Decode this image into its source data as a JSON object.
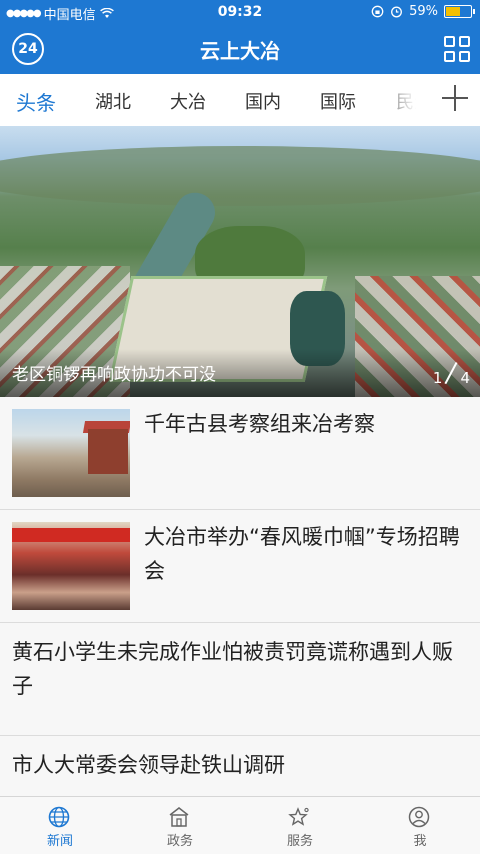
{
  "status_bar": {
    "carrier": "中国电信",
    "time": "09:32",
    "battery": "59%",
    "battery_level": 0.59
  },
  "header": {
    "logo": "24",
    "title": "云上大冶"
  },
  "tabs": [
    {
      "label": "头条",
      "active": true
    },
    {
      "label": "湖北"
    },
    {
      "label": "大冶"
    },
    {
      "label": "国内"
    },
    {
      "label": "国际"
    },
    {
      "label": "民生"
    }
  ],
  "hero": {
    "caption": "老区铜锣再响政协功不可没",
    "page_current": "1",
    "page_total": "4"
  },
  "news": [
    {
      "title": "千年古县考察组来冶考察",
      "has_image": true
    },
    {
      "title": "大冶市举办“春风暖巾帼”专场招聘会",
      "has_image": true
    },
    {
      "title": "黄石小学生未完成作业怕被责罚竟谎称遇到人贩子",
      "has_image": false
    },
    {
      "title": "市人大常委会领导赴铁山调研",
      "has_image": false
    }
  ],
  "bottom_nav": [
    {
      "label": "新闻",
      "icon": "globe-icon",
      "active": true
    },
    {
      "label": "政务",
      "icon": "government-icon"
    },
    {
      "label": "服务",
      "icon": "star-service-icon"
    },
    {
      "label": "我",
      "icon": "user-icon"
    }
  ],
  "colors": {
    "brand": "#1e78d2",
    "text": "#222222",
    "divider": "#dcdcdc"
  }
}
